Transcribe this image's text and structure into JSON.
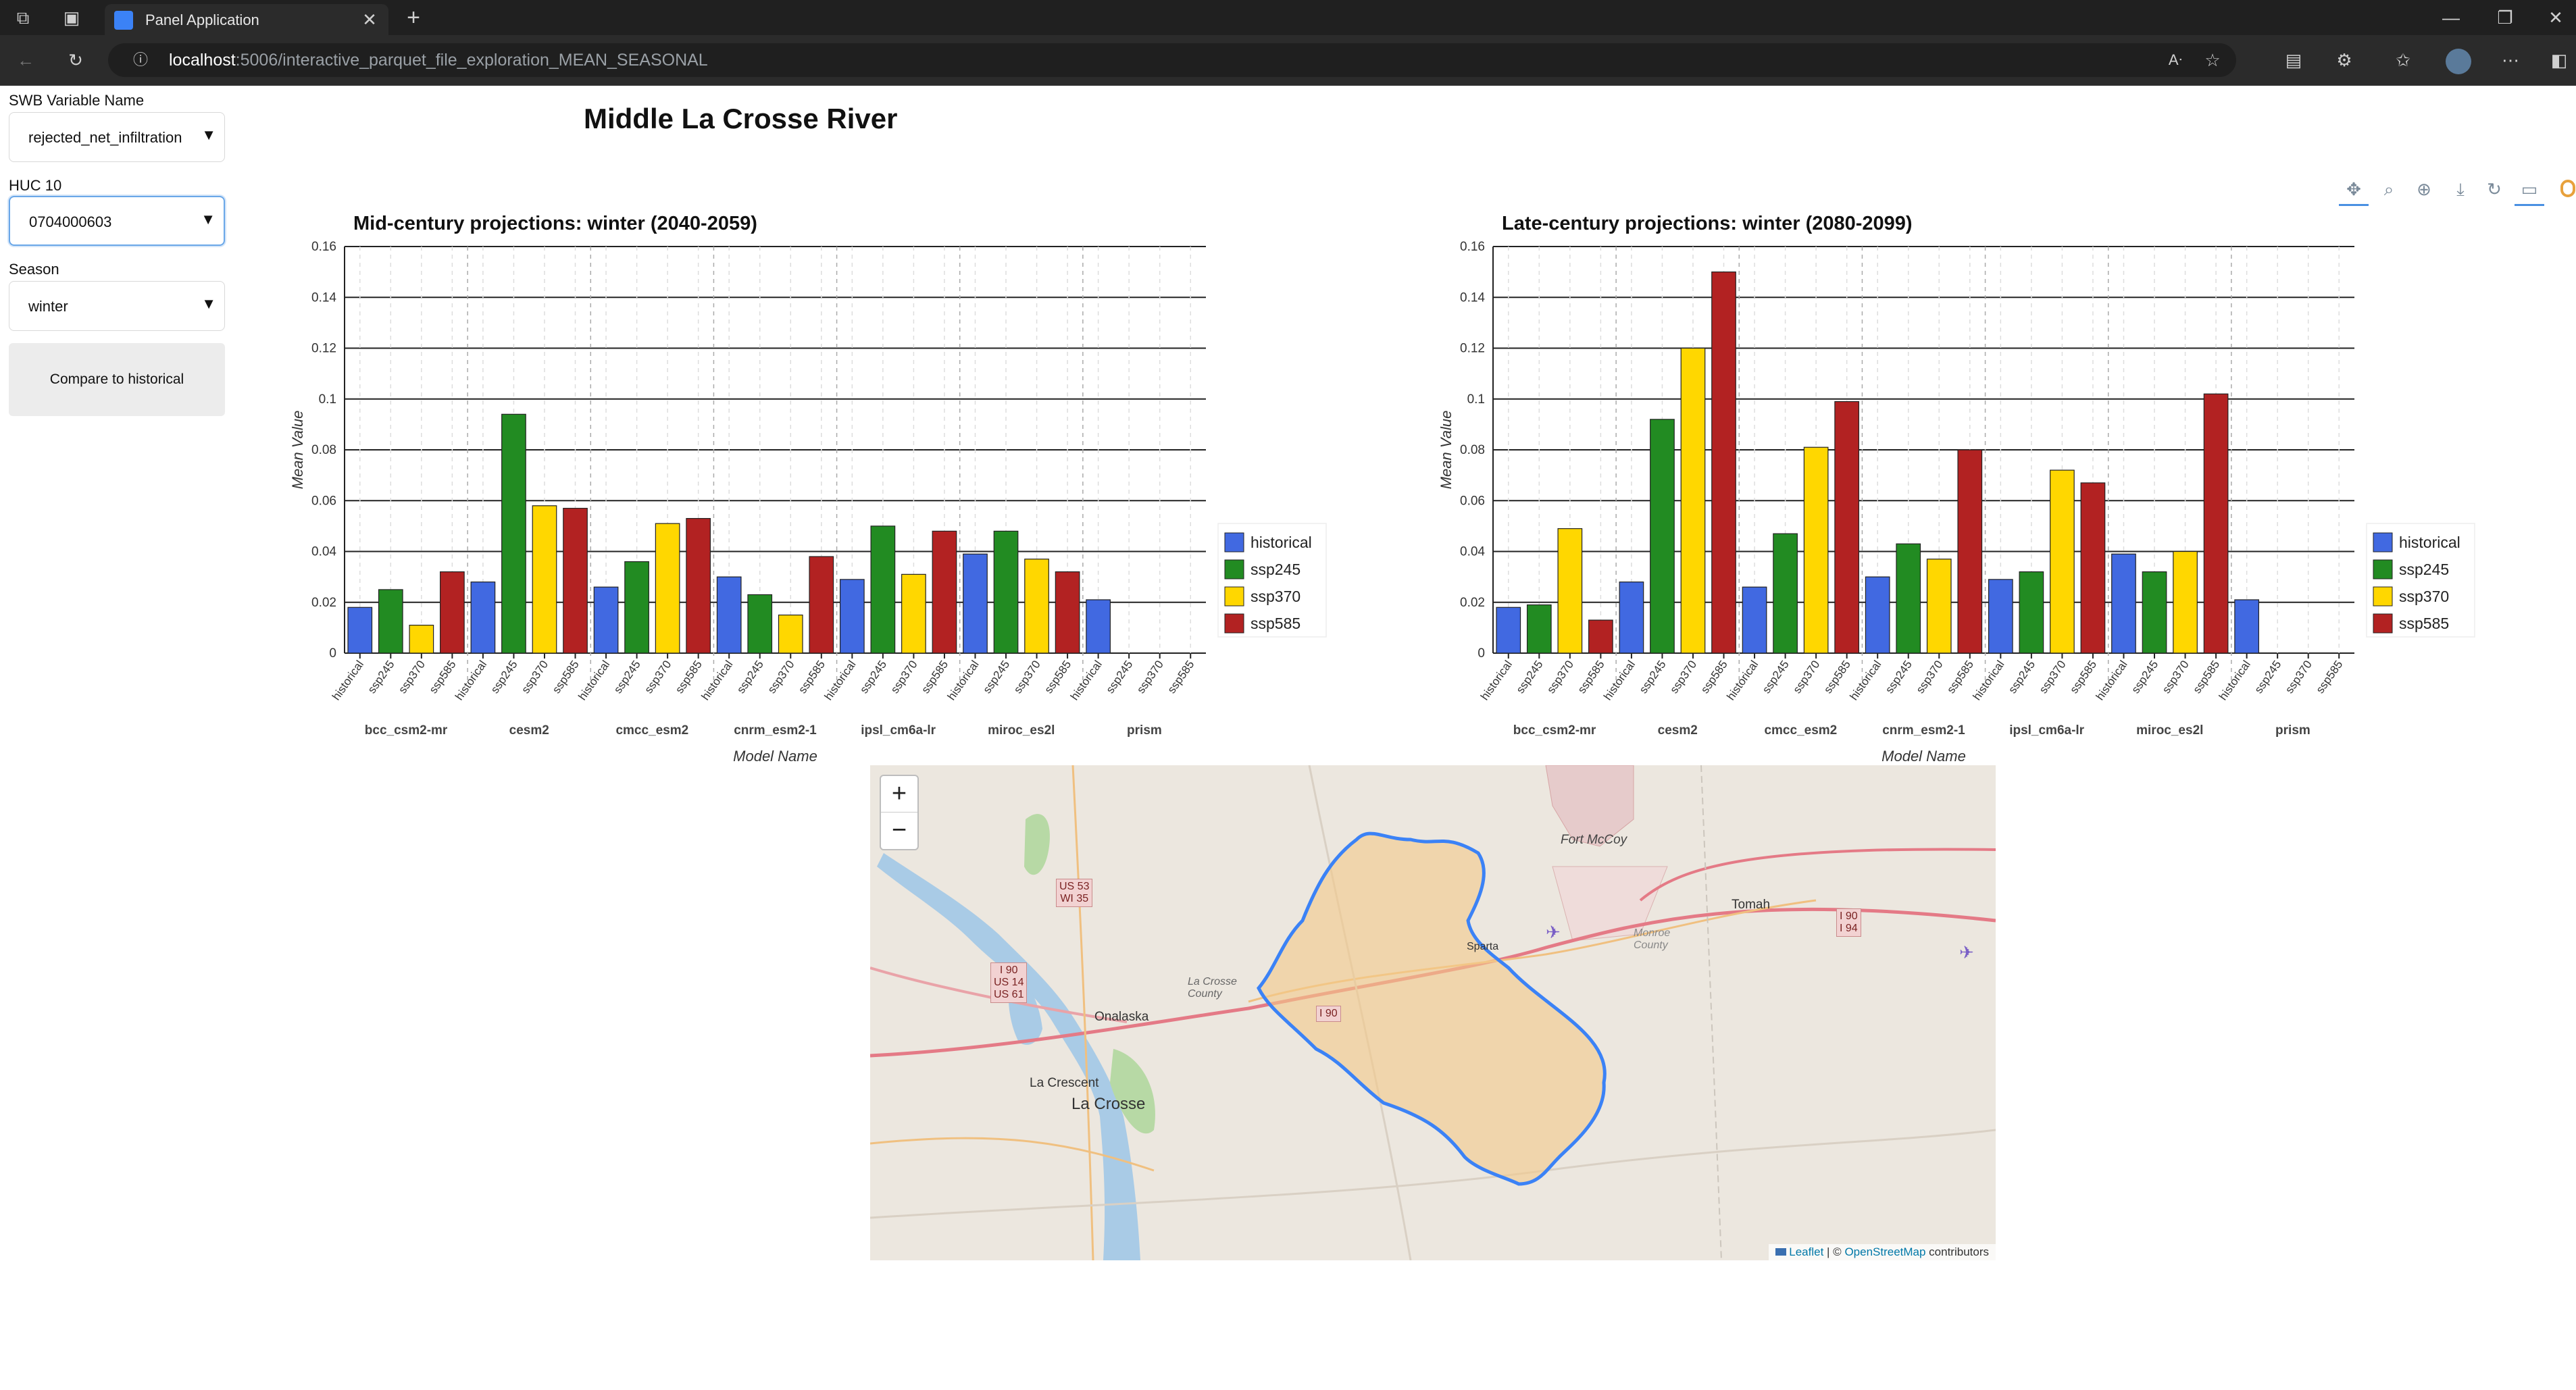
{
  "browser": {
    "tab_title": "Panel Application",
    "url_host": "localhost",
    "url_rest": ":5006/interactive_parquet_file_exploration_MEAN_SEASONAL"
  },
  "sidebar": {
    "var_label": "SWB Variable Name",
    "var_value": "rejected_net_infiltration",
    "huc_label": "HUC 10",
    "huc_value": "0704000603",
    "season_label": "Season",
    "season_value": "winter",
    "compare_button": "Compare to historical"
  },
  "page_title": "Middle La Crosse River",
  "colors": {
    "historical": "#4169e1",
    "ssp245": "#228b22",
    "ssp370": "#ffd700",
    "ssp585": "#b22222",
    "watershed_fill": "#f4c98a",
    "watershed_stroke": "#3b82f6"
  },
  "chart_data": [
    {
      "type": "bar",
      "title": "Mid-century projections: winter (2040-2059)",
      "xlabel": "Model Name",
      "ylabel": "Mean Value",
      "ylim": [
        0,
        0.16
      ],
      "yticks": [
        "0",
        "0.02",
        "0.04",
        "0.06",
        "0.08",
        "0.1",
        "0.12",
        "0.14",
        "0.16"
      ],
      "groups": [
        "bcc_csm2-mr",
        "cesm2",
        "cmcc_esm2",
        "cnrm_esm2-1",
        "ipsl_cm6a-lr",
        "miroc_es2l",
        "prism"
      ],
      "subcategories": [
        "historical",
        "ssp245",
        "ssp370",
        "ssp585"
      ],
      "legend": [
        "historical",
        "ssp245",
        "ssp370",
        "ssp585"
      ],
      "series": [
        {
          "name": "historical",
          "values": [
            0.018,
            0.028,
            0.026,
            0.03,
            0.029,
            0.039,
            0.021
          ]
        },
        {
          "name": "ssp245",
          "values": [
            0.025,
            0.094,
            0.036,
            0.023,
            0.05,
            0.048,
            null
          ]
        },
        {
          "name": "ssp370",
          "values": [
            0.011,
            0.058,
            0.051,
            0.015,
            0.031,
            0.037,
            null
          ]
        },
        {
          "name": "ssp585",
          "values": [
            0.032,
            0.057,
            0.053,
            0.038,
            0.048,
            0.032,
            null
          ]
        }
      ]
    },
    {
      "type": "bar",
      "title": "Late-century projections: winter (2080-2099)",
      "xlabel": "Model Name",
      "ylabel": "Mean Value",
      "ylim": [
        0,
        0.16
      ],
      "yticks": [
        "0",
        "0.02",
        "0.04",
        "0.06",
        "0.08",
        "0.1",
        "0.12",
        "0.14",
        "0.16"
      ],
      "groups": [
        "bcc_csm2-mr",
        "cesm2",
        "cmcc_esm2",
        "cnrm_esm2-1",
        "ipsl_cm6a-lr",
        "miroc_es2l",
        "prism"
      ],
      "subcategories": [
        "historical",
        "ssp245",
        "ssp370",
        "ssp585"
      ],
      "legend": [
        "historical",
        "ssp245",
        "ssp370",
        "ssp585"
      ],
      "series": [
        {
          "name": "historical",
          "values": [
            0.018,
            0.028,
            0.026,
            0.03,
            0.029,
            0.039,
            0.021
          ]
        },
        {
          "name": "ssp245",
          "values": [
            0.019,
            0.092,
            0.047,
            0.043,
            0.032,
            0.032,
            null
          ]
        },
        {
          "name": "ssp370",
          "values": [
            0.049,
            0.12,
            0.081,
            0.037,
            0.072,
            0.04,
            null
          ]
        },
        {
          "name": "ssp585",
          "values": [
            0.013,
            0.15,
            0.099,
            0.08,
            0.067,
            0.102,
            null
          ]
        }
      ]
    }
  ],
  "map": {
    "zoom_in": "+",
    "zoom_out": "−",
    "labels": {
      "fort_mccoy": "Fort McCoy",
      "tomah": "Tomah",
      "sparta": "Sparta",
      "onalaska": "Onalaska",
      "la_crescent": "La Crescent",
      "la_crosse": "La Crosse",
      "la_crosse_county": "La Crosse County",
      "monroe_county": "Monroe County"
    },
    "shields": {
      "us53": "US 53",
      "wi35": "WI 35",
      "i90a": "I 90",
      "us14": "US 14",
      "us61": "US 61",
      "i90b": "I 90",
      "i90c": "I 90",
      "i94": "I 94"
    },
    "attribution": {
      "leaflet": "Leaflet",
      "sep": " | © ",
      "osm": "OpenStreetMap",
      "tail": " contributors"
    }
  }
}
